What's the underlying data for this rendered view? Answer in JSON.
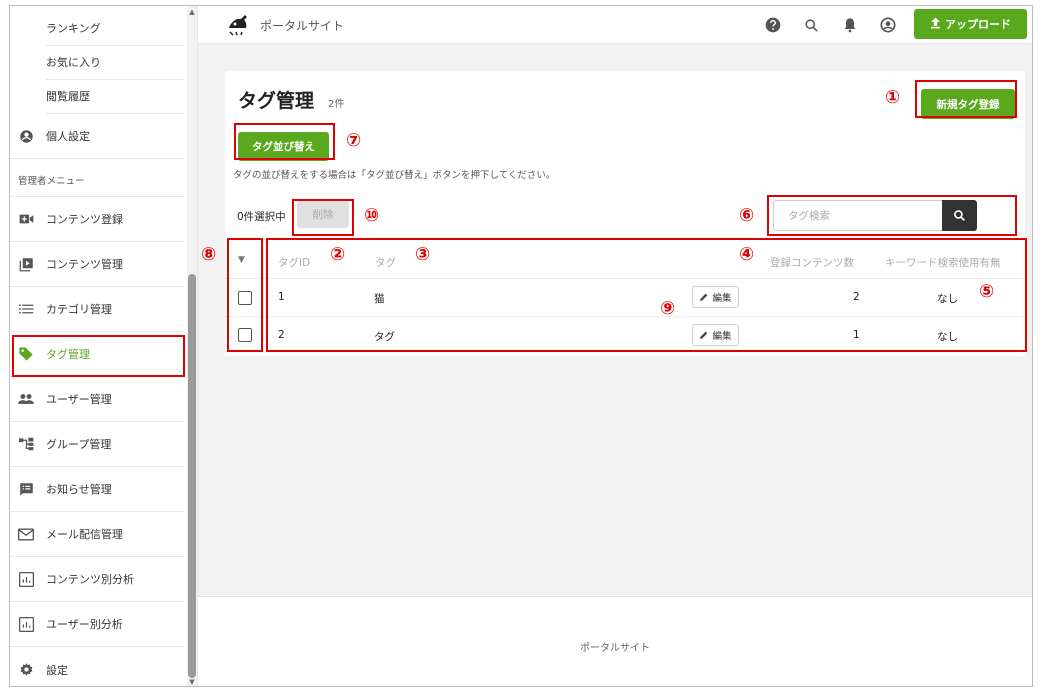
{
  "sidebar": {
    "sub_items": [
      {
        "label": "ランキング"
      },
      {
        "label": "お気に入り"
      },
      {
        "label": "閲覧履歴"
      }
    ],
    "personal_settings": {
      "label": "個人設定",
      "icon": "account-circle-icon"
    },
    "admin_section_label": "管理者メニュー",
    "admin_items": [
      {
        "label": "コンテンツ登録",
        "icon": "video-add-icon"
      },
      {
        "label": "コンテンツ管理",
        "icon": "video-library-icon"
      },
      {
        "label": "カテゴリ管理",
        "icon": "list-icon"
      },
      {
        "label": "タグ管理",
        "icon": "tag-icon"
      },
      {
        "label": "ユーザー管理",
        "icon": "people-icon"
      },
      {
        "label": "グループ管理",
        "icon": "group-tree-icon"
      },
      {
        "label": "お知らせ管理",
        "icon": "announcement-icon"
      },
      {
        "label": "メール配信管理",
        "icon": "mail-icon"
      },
      {
        "label": "コンテンツ別分析",
        "icon": "chart-icon"
      },
      {
        "label": "ユーザー別分析",
        "icon": "chart-icon"
      },
      {
        "label": "設定",
        "icon": "gear-icon"
      }
    ],
    "active_item": "タグ管理"
  },
  "header": {
    "site_title": "ポータルサイト",
    "upload_label": "アップロード"
  },
  "page": {
    "title": "タグ管理",
    "count": "2件",
    "new_tag_button": "新規タグ登録",
    "sort_button": "タグ並び替え",
    "hint": "タグの並び替えをする場合は「タグ並び替え」ボタンを押下してください。",
    "selected_label": "0件選択中",
    "delete_button": "削除",
    "search_placeholder": "タグ検索"
  },
  "table": {
    "columns": [
      "タグID",
      "タグ",
      "登録コンテンツ数",
      "キーワード検索使用有無"
    ],
    "rows": [
      {
        "id": "1",
        "tag": "猫",
        "edit": "編集",
        "count": "2",
        "keyword": "なし"
      },
      {
        "id": "2",
        "tag": "タグ",
        "edit": "編集",
        "count": "1",
        "keyword": "なし"
      }
    ]
  },
  "footer": {
    "text": "ポータルサイト"
  },
  "annotations": [
    "①",
    "②",
    "③",
    "④",
    "⑤",
    "⑥",
    "⑦",
    "⑧",
    "⑨",
    "⑩"
  ],
  "colors": {
    "accent": "#5aa81e",
    "annotation": "#e00000"
  }
}
